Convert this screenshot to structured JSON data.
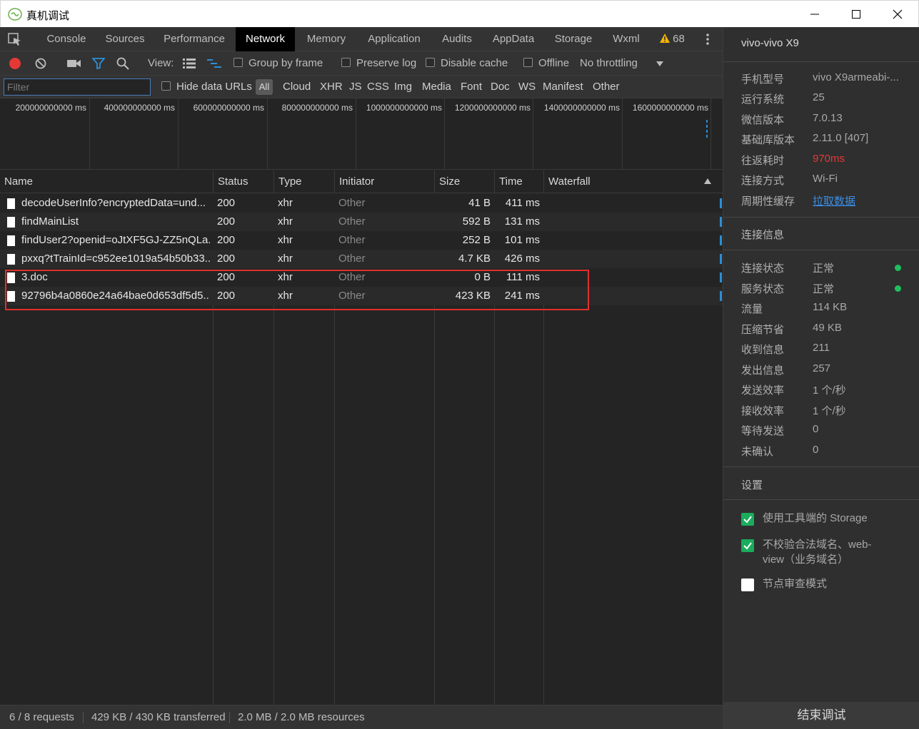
{
  "window": {
    "title": "真机调试"
  },
  "tabs": [
    "Console",
    "Sources",
    "Performance",
    "Network",
    "Memory",
    "Application",
    "Audits",
    "AppData",
    "Storage",
    "Wxml"
  ],
  "warning_count": "68",
  "toolbar": {
    "view_label": "View:",
    "group_by_frame": "Group by frame",
    "preserve_log": "Preserve log",
    "disable_cache": "Disable cache",
    "offline": "Offline",
    "throttling": "No throttling"
  },
  "filterbar": {
    "filter_placeholder": "Filter",
    "hide_data_urls": "Hide data URLs",
    "all": "All",
    "types": [
      "Cloud",
      "XHR",
      "JS",
      "CSS",
      "Img",
      "Media",
      "Font",
      "Doc",
      "WS",
      "Manifest",
      "Other"
    ]
  },
  "overview_ticks": [
    "200000000000 ms",
    "400000000000 ms",
    "600000000000 ms",
    "800000000000 ms",
    "1000000000000 ms",
    "1200000000000 ms",
    "1400000000000 ms",
    "1600000000000 ms"
  ],
  "columns": {
    "name": "Name",
    "status": "Status",
    "type": "Type",
    "initiator": "Initiator",
    "size": "Size",
    "time": "Time",
    "waterfall": "Waterfall"
  },
  "requests": [
    {
      "name": "decodeUserInfo?encryptedData=und...",
      "status": "200",
      "type": "xhr",
      "initiator": "Other",
      "size": "41 B",
      "time": "411 ms"
    },
    {
      "name": "findMainList",
      "status": "200",
      "type": "xhr",
      "initiator": "Other",
      "size": "592 B",
      "time": "131 ms"
    },
    {
      "name": "findUser2?openid=oJtXF5GJ-ZZ5nQLa...",
      "status": "200",
      "type": "xhr",
      "initiator": "Other",
      "size": "252 B",
      "time": "101 ms"
    },
    {
      "name": "pxxq?tTrainId=c952ee1019a54b50b33...",
      "status": "200",
      "type": "xhr",
      "initiator": "Other",
      "size": "4.7 KB",
      "time": "426 ms"
    },
    {
      "name": "3.doc",
      "status": "200",
      "type": "xhr",
      "initiator": "Other",
      "size": "0 B",
      "time": "111 ms"
    },
    {
      "name": "92796b4a0860e24a64bae0d653df5d5...",
      "status": "200",
      "type": "xhr",
      "initiator": "Other",
      "size": "423 KB",
      "time": "241 ms"
    }
  ],
  "statusbar": {
    "requests": "6 / 8 requests",
    "transferred": "429 KB / 430 KB transferred",
    "resources": "2.0 MB / 2.0 MB resources"
  },
  "panel": {
    "device": "vivo-vivo X9",
    "info": [
      {
        "k": "手机型号",
        "v": "vivo X9armeabi-..."
      },
      {
        "k": "运行系统",
        "v": "25"
      },
      {
        "k": "微信版本",
        "v": "7.0.13"
      },
      {
        "k": "基础库版本",
        "v": "2.11.0 [407]"
      },
      {
        "k": "往返耗时",
        "v": "970ms"
      },
      {
        "k": "连接方式",
        "v": "Wi-Fi"
      },
      {
        "k": "周期性缓存",
        "v": "拉取数据"
      }
    ],
    "conn_title": "连接信息",
    "conn": [
      {
        "k": "连接状态",
        "v": "正常"
      },
      {
        "k": "服务状态",
        "v": "正常"
      },
      {
        "k": "流量",
        "v": "114 KB"
      },
      {
        "k": "压缩节省",
        "v": "49 KB"
      },
      {
        "k": "收到信息",
        "v": "211"
      },
      {
        "k": "发出信息",
        "v": "257"
      },
      {
        "k": "发送效率",
        "v": "1 个/秒"
      },
      {
        "k": "接收效率",
        "v": "1 个/秒"
      },
      {
        "k": "等待发送",
        "v": "0"
      },
      {
        "k": "未确认",
        "v": "0"
      }
    ],
    "settings_title": "设置",
    "settings": [
      {
        "line1": "使用工具端的 Storage",
        "line2": "",
        "checked": true
      },
      {
        "line1": "不校验合法域名、web-",
        "line2": "view（业务域名）",
        "checked": true
      },
      {
        "line1": "节点审查模式",
        "line2": "",
        "checked": false
      }
    ],
    "end_button": "结束调试"
  },
  "colors": {
    "accent": "#2d8fd6",
    "record": "#e53935",
    "ok": "#1fbf5e",
    "highlight": "#e0302b"
  }
}
